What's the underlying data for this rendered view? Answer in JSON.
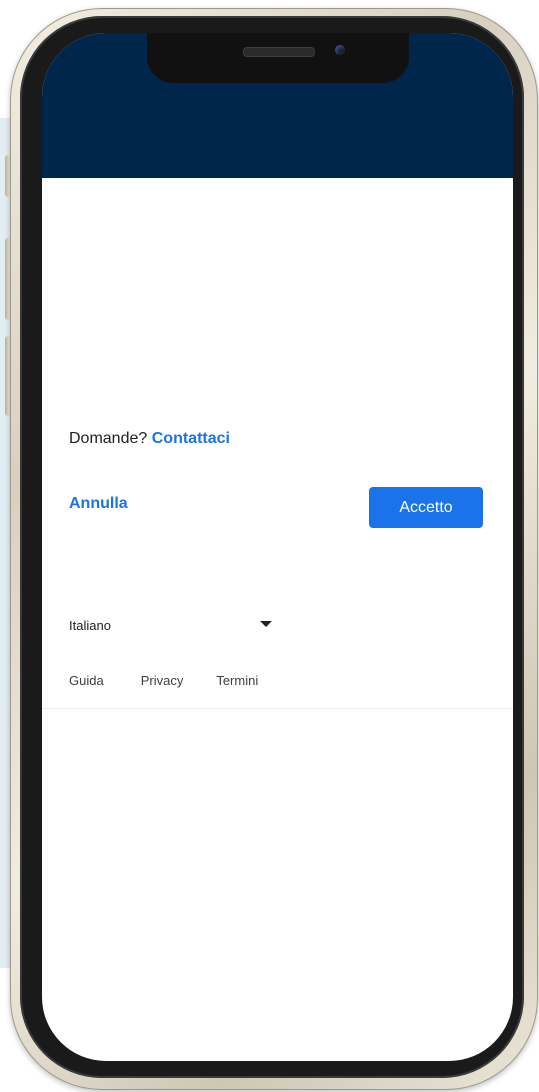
{
  "dialog": {
    "questions_prefix": "Domande?",
    "contact_link": "Contattaci",
    "cancel_label": "Annulla",
    "accept_label": "Accetto"
  },
  "footer": {
    "language": "Italiano",
    "links": [
      "Guida",
      "Privacy",
      "Termini"
    ]
  },
  "colors": {
    "header": "#00264c",
    "accent": "#1a73e8",
    "background_card": "#e3edf4"
  },
  "icons": {
    "dropdown": "caret-down-icon"
  }
}
